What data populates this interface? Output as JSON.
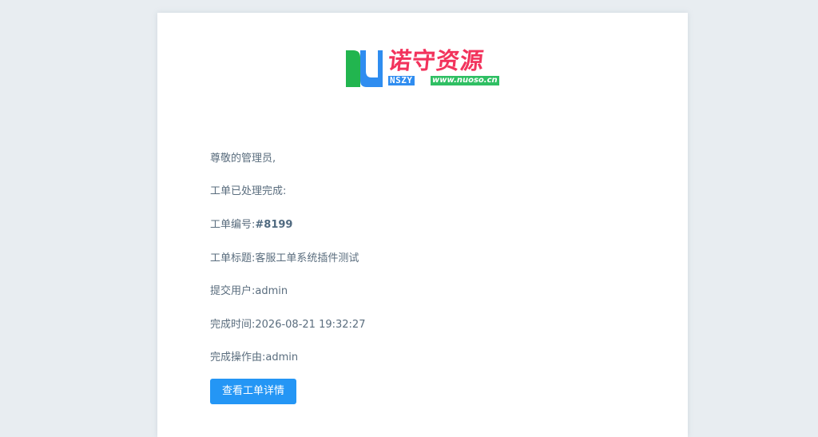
{
  "logo": {
    "title": "诺守资源",
    "abbr": "NSZY",
    "url": "www.nuoso.cn"
  },
  "email": {
    "greeting": "尊敬的管理员,",
    "intro": "工单已处理完成:",
    "fields": [
      {
        "label": "工单编号:",
        "value": "#8199"
      },
      {
        "label": "工单标题:",
        "value": "客服工单系统插件测试"
      },
      {
        "label": "提交用户:",
        "value": "admin"
      },
      {
        "label": "完成时间:",
        "value": "2026-08-21 19:32:27"
      },
      {
        "label": "完成操作由:",
        "value": "admin"
      }
    ],
    "button_label": "查看工单详情"
  },
  "colors": {
    "page_bg": "#e8edf1",
    "card_bg": "#ffffff",
    "button": "#2496f5",
    "logo_red": "#f2335c",
    "logo_green": "#22b54f",
    "logo_blue": "#2f8df0"
  }
}
